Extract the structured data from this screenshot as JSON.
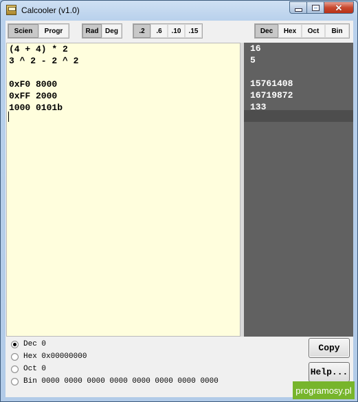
{
  "window": {
    "title": "Calcooler (v1.0)"
  },
  "toolbar": {
    "mode": [
      {
        "label": "Scien",
        "active": true
      },
      {
        "label": "Progr",
        "active": false
      }
    ],
    "angle": [
      {
        "label": "Rad",
        "active": true
      },
      {
        "label": "Deg",
        "active": false
      }
    ],
    "precision": [
      {
        "label": ".2",
        "active": true
      },
      {
        "label": ".6",
        "active": false
      },
      {
        "label": ".10",
        "active": false
      },
      {
        "label": ".15",
        "active": false
      }
    ],
    "base": [
      {
        "label": "Dec",
        "active": true
      },
      {
        "label": "Hex",
        "active": false
      },
      {
        "label": "Oct",
        "active": false
      },
      {
        "label": "Bin",
        "active": false
      }
    ]
  },
  "editor": {
    "lines": [
      "(4 + 4) * 2",
      "3 ^ 2 - 2 ^ 2",
      "",
      "0xF0 8000",
      "0xFF 2000",
      "1000 0101b",
      ""
    ]
  },
  "results": {
    "lines": [
      "16",
      "5",
      "",
      "15761408",
      "16719872",
      "133",
      ""
    ]
  },
  "conversions": [
    {
      "label": "Dec 0",
      "selected": true
    },
    {
      "label": "Hex 0x00000000",
      "selected": false
    },
    {
      "label": "Oct 0",
      "selected": false
    },
    {
      "label": "Bin 0000 0000 0000 0000 0000 0000 0000 0000",
      "selected": false
    }
  ],
  "buttons": {
    "copy": "Copy",
    "help": "Help..."
  },
  "watermark": "programosy.pl"
}
